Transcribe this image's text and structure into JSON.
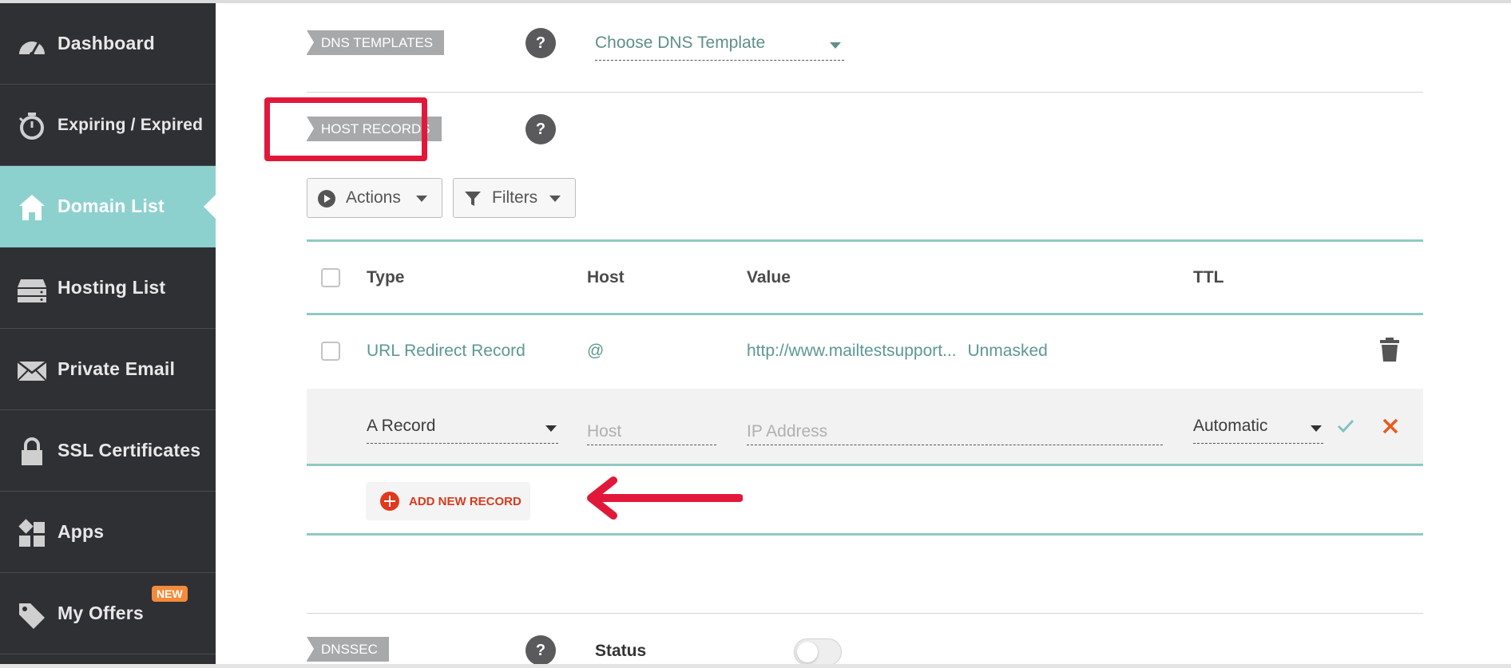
{
  "sidebar": {
    "items": [
      {
        "label": "Dashboard",
        "icon": "speedometer-icon"
      },
      {
        "label": "Expiring / Expired",
        "icon": "stopwatch-icon"
      },
      {
        "label": "Domain List",
        "icon": "home-icon",
        "active": true
      },
      {
        "label": "Hosting List",
        "icon": "server-icon"
      },
      {
        "label": "Private Email",
        "icon": "envelope-icon"
      },
      {
        "label": "SSL Certificates",
        "icon": "lock-icon"
      },
      {
        "label": "Apps",
        "icon": "apps-icon"
      },
      {
        "label": "My Offers",
        "icon": "tag-icon",
        "badge": "NEW"
      }
    ]
  },
  "dns_templates": {
    "label": "DNS TEMPLATES",
    "help": "?",
    "select_label": "Choose DNS Template"
  },
  "host_records": {
    "label": "HOST RECORDS",
    "help": "?",
    "actions_label": "Actions",
    "filters_label": "Filters",
    "columns": {
      "type": "Type",
      "host": "Host",
      "value": "Value",
      "ttl": "TTL"
    },
    "rows": [
      {
        "type": "URL Redirect Record",
        "host": "@",
        "value": "http://www.mailtestsupport...",
        "extra": "Unmasked"
      }
    ],
    "new_record": {
      "type": "A Record",
      "host_placeholder": "Host",
      "value_placeholder": "IP Address",
      "ttl": "Automatic"
    },
    "add_label": "ADD NEW RECORD"
  },
  "dnssec": {
    "label": "DNSSEC",
    "help": "?",
    "status_label": "Status"
  },
  "colors": {
    "sidebar_bg": "#2f3033",
    "active_bg": "#8dd1cf",
    "teal_accent": "#8fc9c3",
    "link_teal": "#5c9893",
    "add_red": "#e0391c",
    "annotation_red": "#e2183b",
    "badge_orange": "#f48a3a"
  }
}
